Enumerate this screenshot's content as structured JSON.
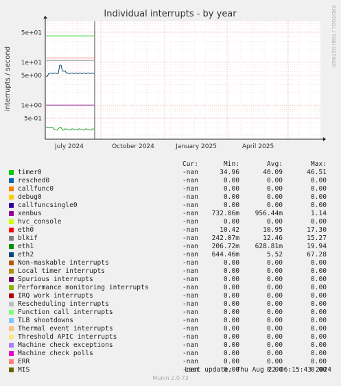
{
  "chart_data": {
    "type": "line",
    "title": "Individual interrupts - by year",
    "ylabel": "interrupts / second",
    "watermark": "RRDTOOL / TOBI OETIKER",
    "yscale": "log",
    "ylim": [
      0.16,
      90
    ],
    "x_ticks": [
      "July 2024",
      "October 2024",
      "January 2025",
      "April 2025"
    ],
    "y_ticks": [
      {
        "label": "5e+01",
        "value": 50
      },
      {
        "label": "1e+01",
        "value": 10
      },
      {
        "label": "5e+00",
        "value": 5
      },
      {
        "label": "1e+00",
        "value": 1
      },
      {
        "label": "5e-01",
        "value": 0.5
      }
    ],
    "series": [
      {
        "name": "timer0",
        "color": "#00cc00",
        "shape": "flat",
        "value": 41
      },
      {
        "name": "eth1",
        "color": "#ff8080",
        "shape": "flat",
        "value": 12.5
      },
      {
        "name": "blkif",
        "color": "#888888",
        "shape": "flat",
        "value": 11
      },
      {
        "name": "eth2",
        "color": "#004a6f",
        "shape": "eth2",
        "value": 5.5
      },
      {
        "name": "xenbus",
        "color": "#8a1a8a",
        "shape": "flat",
        "value": 1.0
      },
      {
        "name": "eth0",
        "color": "#1e9e1e",
        "shape": "eth0",
        "value": 0.27
      }
    ],
    "columns": [
      "Cur:",
      "Min:",
      "Avg:",
      "Max:"
    ],
    "legend": [
      {
        "name": "timer0",
        "color": "#00cc00",
        "cur": "-nan",
        "min": "34.96",
        "avg": "40.09",
        "max": "46.51"
      },
      {
        "name": "resched0",
        "color": "#0066b3",
        "cur": "-nan",
        "min": "0.00",
        "avg": "0.00",
        "max": "0.00"
      },
      {
        "name": "callfunc0",
        "color": "#ff8000",
        "cur": "-nan",
        "min": "0.00",
        "avg": "0.00",
        "max": "0.00"
      },
      {
        "name": "debug0",
        "color": "#ffcc00",
        "cur": "-nan",
        "min": "0.00",
        "avg": "0.00",
        "max": "0.00"
      },
      {
        "name": "callfuncsingle0",
        "color": "#330099",
        "cur": "-nan",
        "min": "0.00",
        "avg": "0.00",
        "max": "0.00"
      },
      {
        "name": "xenbus",
        "color": "#990099",
        "cur": "-nan",
        "min": "732.06m",
        "avg": "956.44m",
        "max": "1.14"
      },
      {
        "name": "hvc_console",
        "color": "#ccff00",
        "cur": "-nan",
        "min": "0.00",
        "avg": "0.00",
        "max": "0.00"
      },
      {
        "name": "eth0",
        "color": "#ff0000",
        "cur": "-nan",
        "min": "10.42",
        "avg": "10.95",
        "max": "17.30"
      },
      {
        "name": "blkif",
        "color": "#808080",
        "cur": "-nan",
        "min": "242.07m",
        "avg": "12.46",
        "max": "15.27"
      },
      {
        "name": "eth1",
        "color": "#008f00",
        "cur": "-nan",
        "min": "206.72m",
        "avg": "628.81m",
        "max": "19.94"
      },
      {
        "name": "eth2",
        "color": "#00487d",
        "cur": "-nan",
        "min": "644.46m",
        "avg": "5.52",
        "max": "67.28"
      },
      {
        "name": "Non-maskable interrupts",
        "color": "#b35a00",
        "cur": "-nan",
        "min": "0.00",
        "avg": "0.00",
        "max": "0.00"
      },
      {
        "name": "Local timer interrupts",
        "color": "#b38f00",
        "cur": "-nan",
        "min": "0.00",
        "avg": "0.00",
        "max": "0.00"
      },
      {
        "name": "Spurious interrupts",
        "color": "#6b006b",
        "cur": "-nan",
        "min": "0.00",
        "avg": "0.00",
        "max": "0.00"
      },
      {
        "name": "Performance monitoring interrupts",
        "color": "#8fb300",
        "cur": "-nan",
        "min": "0.00",
        "avg": "0.00",
        "max": "0.00"
      },
      {
        "name": "IRQ work interrupts",
        "color": "#b30000",
        "cur": "-nan",
        "min": "0.00",
        "avg": "0.00",
        "max": "0.00"
      },
      {
        "name": "Rescheduling interrupts",
        "color": "#bebebe",
        "cur": "-nan",
        "min": "0.00",
        "avg": "0.00",
        "max": "0.00"
      },
      {
        "name": "Function call interrupts",
        "color": "#80ff80",
        "cur": "-nan",
        "min": "0.00",
        "avg": "0.00",
        "max": "0.00"
      },
      {
        "name": "TLB shootdowns",
        "color": "#80c9ff",
        "cur": "-nan",
        "min": "0.00",
        "avg": "0.00",
        "max": "0.00"
      },
      {
        "name": "Thermal event interrupts",
        "color": "#ffc080",
        "cur": "-nan",
        "min": "0.00",
        "avg": "0.00",
        "max": "0.00"
      },
      {
        "name": "Threshold APIC interrupts",
        "color": "#ffe680",
        "cur": "-nan",
        "min": "0.00",
        "avg": "0.00",
        "max": "0.00"
      },
      {
        "name": "Machine check exceptions",
        "color": "#aa80ff",
        "cur": "-nan",
        "min": "0.00",
        "avg": "0.00",
        "max": "0.00"
      },
      {
        "name": "Machine check polls",
        "color": "#ee00cc",
        "cur": "-nan",
        "min": "0.00",
        "avg": "0.00",
        "max": "0.00"
      },
      {
        "name": "ERR",
        "color": "#ff8080",
        "cur": "-nan",
        "min": "0.00",
        "avg": "0.00",
        "max": "0.00"
      },
      {
        "name": "MIS",
        "color": "#666600",
        "cur": "-nan",
        "min": "0.00",
        "avg": "0.00",
        "max": "0.00"
      }
    ]
  },
  "footer": {
    "last_update": "Last update: Thu Aug 22 06:15:43 2024",
    "generator": "Munin 2.0.73"
  }
}
